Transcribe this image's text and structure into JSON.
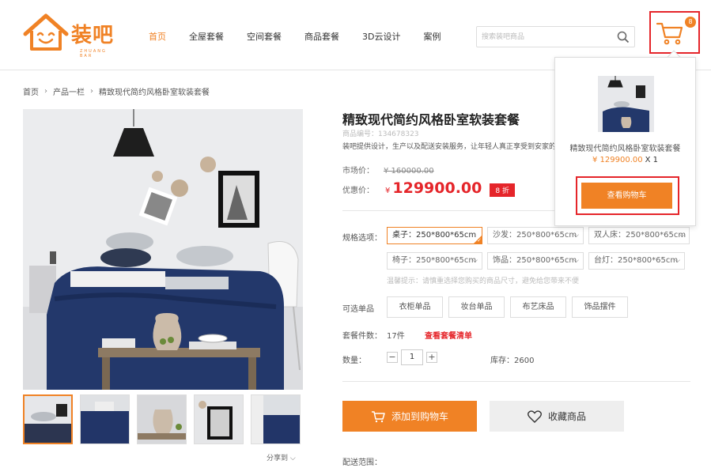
{
  "logo": {
    "text": "装吧",
    "sub": "ZHUANG BAR"
  },
  "nav": [
    {
      "label": "首页",
      "active": true
    },
    {
      "label": "全屋套餐"
    },
    {
      "label": "空间套餐"
    },
    {
      "label": "商品套餐"
    },
    {
      "label": "3D云设计"
    },
    {
      "label": "案例"
    }
  ],
  "search": {
    "placeholder": "搜索装吧商品"
  },
  "cart": {
    "count": "8"
  },
  "breadcrumb": [
    "首页",
    "产品一栏",
    "精致现代简约风格卧室软装套餐"
  ],
  "product": {
    "title": "精致现代简约风格卧室软装套餐",
    "code": "商品编号：134678323",
    "desc": "装吧提供设计，生产以及配送安装服务，让年轻人真正享受到安家的乐趣",
    "market_label": "市场价：",
    "market_price": "¥ 160000.00",
    "sale_label": "优惠价：",
    "sale_yen": "¥",
    "sale_price": "129900.00",
    "discount": "8 折"
  },
  "specs": {
    "label": "规格选项：",
    "items": [
      "桌子：250*800*65cm",
      "沙发：250*800*65cm",
      "双人床：250*800*65cm",
      "椅子：250*800*65cm",
      "饰品：250*800*65cm",
      "台灯：250*800*65cm"
    ],
    "tip": "温馨提示：请慎重选择您购买的商品尺寸，避免给您带来不便"
  },
  "optional": {
    "label": "可选单品",
    "items": [
      "衣柜单品",
      "妆台单品",
      "布艺床品",
      "饰品摆件"
    ]
  },
  "package": {
    "label": "套餐件数：",
    "value": "17件",
    "link": "查看套餐清单"
  },
  "quantity": {
    "label": "数量：",
    "value": "1",
    "minus": "−",
    "plus": "+"
  },
  "stock": "库存：2600",
  "actions": {
    "add_cart": "添加到购物车",
    "favorite": "收藏商品"
  },
  "shipping": "配送范围：",
  "share": "分享到",
  "popup": {
    "name": "精致现代简约风格卧室软装套餐",
    "price": "¥ 129900.00",
    "qty": "X 1",
    "button": "查看购物车"
  },
  "colors": {
    "accent": "#f08225",
    "red": "#e5252a",
    "navy": "#1f3566"
  }
}
